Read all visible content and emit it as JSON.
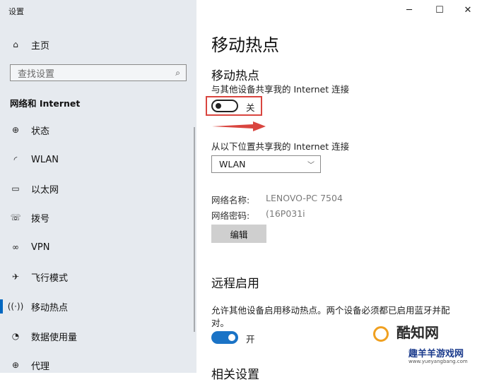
{
  "window": {
    "title": "设置",
    "controls": [
      "─",
      "☐",
      "✕"
    ]
  },
  "sidebar": {
    "home": "主页",
    "search_placeholder": "查找设置",
    "section": "网络和 Internet",
    "items": [
      {
        "label": "状态",
        "icon": "globe-icon"
      },
      {
        "label": "WLAN",
        "icon": "wifi-icon"
      },
      {
        "label": "以太网",
        "icon": "ethernet-icon"
      },
      {
        "label": "拨号",
        "icon": "dialup-icon"
      },
      {
        "label": "VPN",
        "icon": "vpn-icon"
      },
      {
        "label": "飞行模式",
        "icon": "airplane-icon"
      },
      {
        "label": "移动热点",
        "icon": "hotspot-icon"
      },
      {
        "label": "数据使用量",
        "icon": "data-usage-icon"
      },
      {
        "label": "代理",
        "icon": "proxy-icon"
      }
    ],
    "active_item": "移动热点"
  },
  "main": {
    "page_title": "移动热点",
    "hotspot": {
      "heading": "移动热点",
      "desc": "与其他设备共享我的 Internet 连接",
      "toggle_state": "关",
      "toggle_on": false
    },
    "share_from_label": "从以下位置共享我的 Internet 连接",
    "share_from_value": "WLAN",
    "network_name_label": "网络名称:",
    "network_name_value": "LENOVO-PC 7504",
    "network_password_label": "网络密码:",
    "network_password_value": "(16P031i",
    "edit_button": "编辑",
    "remote": {
      "heading": "远程启用",
      "desc_line1": "允许其他设备启用移动热点。两个设备必须都已启用蓝牙并配",
      "desc_line2": "对。",
      "toggle_state": "开",
      "toggle_on": true
    },
    "next_heading_partial": "相关设置"
  },
  "watermark": {
    "line1": "酷知网",
    "line2": "趣羊羊游戏网",
    "url": "www.yueyangbang.com"
  },
  "colors": {
    "accent": "#0067c0",
    "highlight_box": "#d9453f",
    "arrow": "#d9453f",
    "toggle_on": "#1a73c6"
  }
}
